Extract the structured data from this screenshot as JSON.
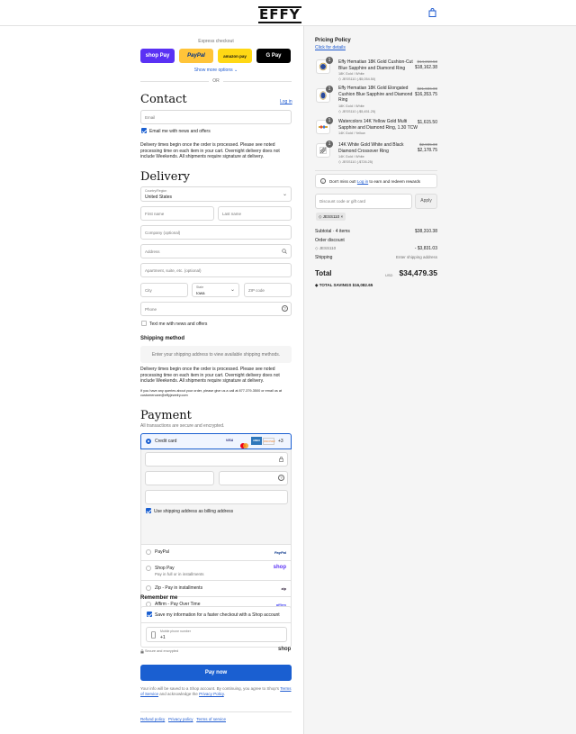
{
  "header": {
    "logo_text": "EFFY",
    "bag_icon": "shopping-bag-icon"
  },
  "express": {
    "label": "Express checkout",
    "buttons": [
      {
        "label": "shop Pay",
        "bg": "#5a31f4",
        "fg": "#ffffff"
      },
      {
        "label": "PayPal",
        "bg": "#ffc439",
        "fg": "#003087"
      },
      {
        "label": "amazon pay",
        "bg": "#ffd814",
        "fg": "#111111"
      },
      {
        "label": "G Pay",
        "bg": "#000000",
        "fg": "#ffffff"
      }
    ],
    "show_more": "Show more options",
    "or": "OR"
  },
  "contact": {
    "title": "Contact",
    "login": "Log in",
    "email_placeholder": "Email",
    "email_news": "Email me with news and offers",
    "notice": "Delivery times begin once the order is processed. Please see noted processing time on each item in your cart. Overnight delivery does not include Weekends. All shipments require signature at delivery."
  },
  "delivery": {
    "title": "Delivery",
    "country_label": "Country/Region",
    "country_value": "United States",
    "first_name": "First name",
    "last_name": "Last name",
    "company": "Company (optional)",
    "address": "Address",
    "apartment": "Apartment, suite, etc. (optional)",
    "city": "City",
    "state_label": "State",
    "state_value": "Iowa",
    "zip": "ZIP code",
    "phone": "Phone",
    "text_news": "Text me with news and offers"
  },
  "shipping": {
    "title": "Shipping method",
    "placeholder": "Enter your shipping address to view available shipping methods.",
    "notice": "Delivery times begin once the order is processed. Please see noted processing time on each item in your cart. Overnight delivery does not include Weekends. All shipments require signature at delivery.",
    "contact_note": "If you have any queries about your order, please give us a call at 877-379-3500 or email us at customercare@effyjewelry.com"
  },
  "payment": {
    "title": "Payment",
    "subtitle": "All transactions are secure and encrypted.",
    "credit_card": "Credit card",
    "card_brands": [
      "VISA",
      "MC",
      "AMEX",
      "DISCOVER"
    ],
    "more_cards": "+3",
    "billing_same": "Use shipping address as billing address",
    "methods": [
      {
        "label": "PayPal",
        "sub": "",
        "logo": "PayPal",
        "logo_color": "#003087"
      },
      {
        "label": "Shop Pay",
        "sub": "Pay in full or in installments",
        "logo": "shop",
        "logo_color": "#5a31f4"
      },
      {
        "label": "Zip - Pay in installments",
        "sub": "",
        "logo": "zip",
        "logo_color": "#1a0826"
      },
      {
        "label": "Affirm - Pay Over Time",
        "sub": "",
        "logo": "affirm",
        "logo_color": "#4a4af4"
      }
    ]
  },
  "remember": {
    "title": "Remember me",
    "save_info": "Save my information for a faster checkout with a Shop account",
    "phone_label": "Mobile phone number",
    "phone_value": "+1",
    "secure": "Secure and encrypted",
    "shop_logo": "shop"
  },
  "pay_now": "Pay now",
  "terms": {
    "prefix": "Your info will be saved to a Shop account. By continuing, you agree to Shop's",
    "tos": "Terms of Service",
    "mid": "and acknowledge the",
    "privacy": "Privacy Policy",
    "suffix": "."
  },
  "footer_links": [
    "Refund policy",
    "Privacy policy",
    "Terms of service"
  ],
  "summary": {
    "pricing_policy": "Pricing Policy",
    "click_details": "Click for details",
    "items": [
      {
        "qty": "1",
        "name": "Effy Hematian 18K Gold Cushion-Cut Blue Sapphire and Diamond Ring",
        "variant": "18K Gold / White",
        "discount": "JESS110 (-$5,054.50)",
        "orig": "$14,218.53",
        "price": "$18,162.38"
      },
      {
        "qty": "1",
        "name": "Effy Hematian 18K Gold Elongated Cushion Blue Sapphire and Diamond Ring",
        "variant": "18K Gold / White",
        "discount": "JESS110 (-$5,451.25)",
        "orig": "$21,606.00",
        "price": "$16,353.75"
      },
      {
        "qty": "1",
        "name": "Watercolors 14K Yellow Gold Multi Sapphire and Diamond Ring, 1.30 TCW",
        "variant": "14K Gold / Yellow",
        "discount": "",
        "orig": "",
        "price": "$1,615.50"
      },
      {
        "qty": "1",
        "name": "14K White Gold White and Black Diamond Crossover Ring",
        "variant": "14K Gold / White",
        "discount": "JESS110 (-$726.25)",
        "orig": "$2,905.00",
        "price": "$2,178.75"
      }
    ],
    "rewards_prefix": "Don't miss out!",
    "rewards_link": "Log in",
    "rewards_suffix": "to earn and redeem rewards",
    "discount_placeholder": "Discount code or gift card",
    "apply": "Apply",
    "code_tag": "JESS110",
    "subtotal_label": "Subtotal · 4 items",
    "subtotal": "$38,310.38",
    "order_discount": "Order discount",
    "discount_code": "JESS110",
    "discount_amount": "- $3,831.03",
    "shipping_label": "Shipping",
    "shipping_value": "Enter shipping address",
    "total_label": "Total",
    "currency": "USD",
    "total": "$34,479.35",
    "savings_label": "TOTAL SAVINGS",
    "savings": "$16,082.65"
  },
  "colors": {
    "accent": "#1a5fd1",
    "link": "#1f5bd0"
  }
}
